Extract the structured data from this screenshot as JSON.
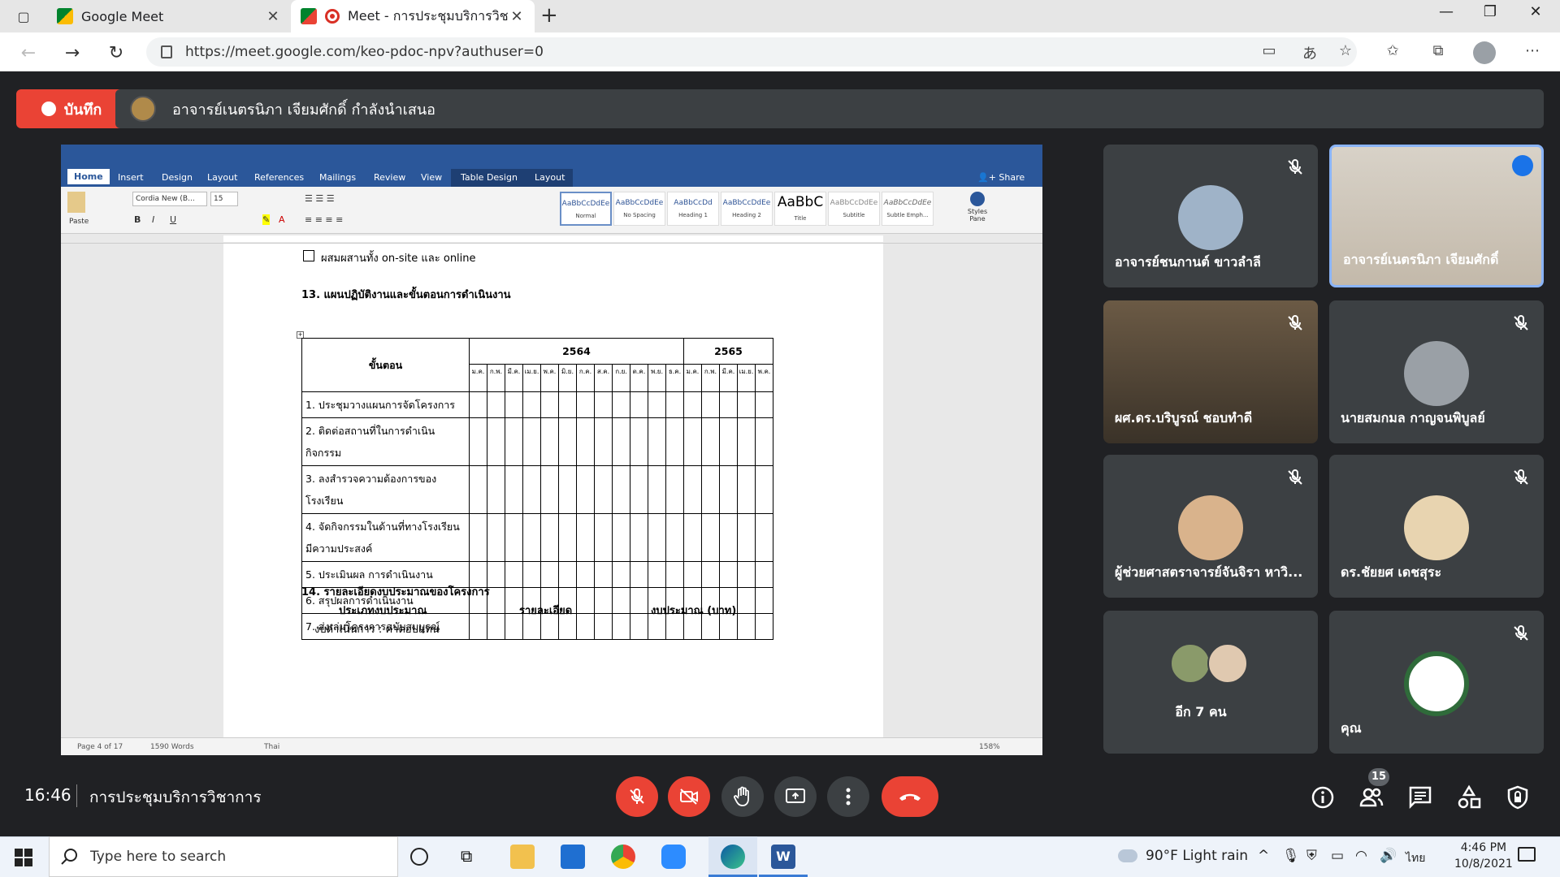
{
  "browser": {
    "tabs": [
      {
        "title": "Google Meet"
      },
      {
        "title": "Meet - การประชุมบริการวิชาการ"
      }
    ],
    "url": "https://meet.google.com/keo-pdoc-npv?authuser=0"
  },
  "meet": {
    "record_label": "บันทึก",
    "presenting_text": "อาจารย์เนตรนิภา เจียมศักดิ์ กำลังนำเสนอ",
    "clock": "16:46",
    "meeting_title": "การประชุมบริการวิชาการ",
    "participant_count": "15",
    "participants": [
      {
        "name": "อาจารย์ชนกานต์ ขาวลำลี",
        "muted": true
      },
      {
        "name": "อาจารย์เนตรนิภา เจียมศักดิ์",
        "muted": false,
        "speaking": true
      },
      {
        "name": "ผศ.ดร.บริบูรณ์ ชอบทำดี",
        "muted": true
      },
      {
        "name": "นายสมกมล กาญจนพิบูลย์",
        "muted": true
      },
      {
        "name": "ผู้ช่วยศาสตราจารย์จันจิรา หาวิ...",
        "muted": true
      },
      {
        "name": "ดร.ชัยยศ เดชสุระ",
        "muted": true
      },
      {
        "name": "อีก 7 คน",
        "muted": false
      },
      {
        "name": "คุณ",
        "muted": true
      }
    ]
  },
  "word": {
    "tabs": [
      "Home",
      "Insert",
      "Design",
      "Layout",
      "References",
      "Mailings",
      "Review",
      "View",
      "Table Design",
      "Layout"
    ],
    "share": "Share",
    "font": "Cordia New (B...",
    "size": "15",
    "paste": "Paste",
    "styles": [
      "Normal",
      "No Spacing",
      "Heading 1",
      "Heading 2",
      "Title",
      "Subtitle",
      "Subtle Emph..."
    ],
    "style_samples": [
      "AaBbCcDdEe",
      "AaBbCcDdEe",
      "AaBbCcDd",
      "AaBbCcDdEe",
      "AaBbC",
      "AaBbCcDdEe",
      "AaBbCcDdEe"
    ],
    "styles_pane": "Styles Pane",
    "status": {
      "page": "Page 4 of 17",
      "words": "1590 Words",
      "lang": "Thai",
      "zoom": "158%"
    },
    "doc": {
      "checkbox_text": "ผสมผสานทั้ง on-site และ online",
      "section13": "13. แผนปฏิบัติงานและขั้นตอนการดำเนินงาน",
      "table": {
        "step_header": "ขั้นตอน",
        "year1": "2564",
        "year2": "2565",
        "months": [
          "ม.ค.",
          "ก.พ.",
          "มี.ค.",
          "เม.ย.",
          "พ.ค.",
          "มิ.ย.",
          "ก.ค.",
          "ส.ค.",
          "ก.ย.",
          "ต.ค.",
          "พ.ย.",
          "ธ.ค.",
          "ม.ค.",
          "ก.พ.",
          "มี.ค.",
          "เม.ย.",
          "พ.ค."
        ],
        "steps": [
          "1. ประชุมวางแผนการจัดโครงการ",
          "2. ติดต่อสถานที่ในการดำเนินกิจกรรม",
          "3. ลงสำรวจความต้องการของโรงเรียน",
          "4. จัดกิจกรรมในด้านที่ทางโรงเรียนมีความประสงค์",
          "5. ประเมินผล การดำเนินงาน",
          "6. สรุปผลการดำเนินงาน",
          "7. ส่งเล่มโครงการฉบับสมบูรณ์"
        ]
      },
      "section14": "14. รายละเอียดงบประมาณของโครงการ",
      "col_type": "ประเภทงบประมาณ",
      "col_detail": "รายละเอียด",
      "col_amount": "งบประมาณ (บาท)",
      "budget_line": "งบดำเนินการ : ค่าตอบแทน"
    }
  },
  "taskbar": {
    "search_placeholder": "Type here to search",
    "weather": "90°F  Light rain",
    "lang": "ไทย",
    "time": "4:46 PM",
    "date": "10/8/2021"
  },
  "colors": {
    "meet_red": "#ea4335",
    "meet_bg": "#202124",
    "tile_bg": "#3c4043",
    "word_blue": "#2b579a",
    "speaking": "#8ab4f8"
  }
}
